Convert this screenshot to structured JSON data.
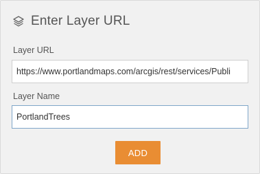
{
  "header": {
    "icon": "layers-icon",
    "title": "Enter Layer URL"
  },
  "layer_url": {
    "label": "Layer URL",
    "value": "https://www.portlandmaps.com/arcgis/rest/services/Publi"
  },
  "layer_name": {
    "label": "Layer Name",
    "value": "PortlandTrees"
  },
  "actions": {
    "add_label": "ADD"
  },
  "colors": {
    "panel_background": "#f1f1f1",
    "add_button": "#e98d33",
    "focused_border": "#7fa6c9"
  }
}
